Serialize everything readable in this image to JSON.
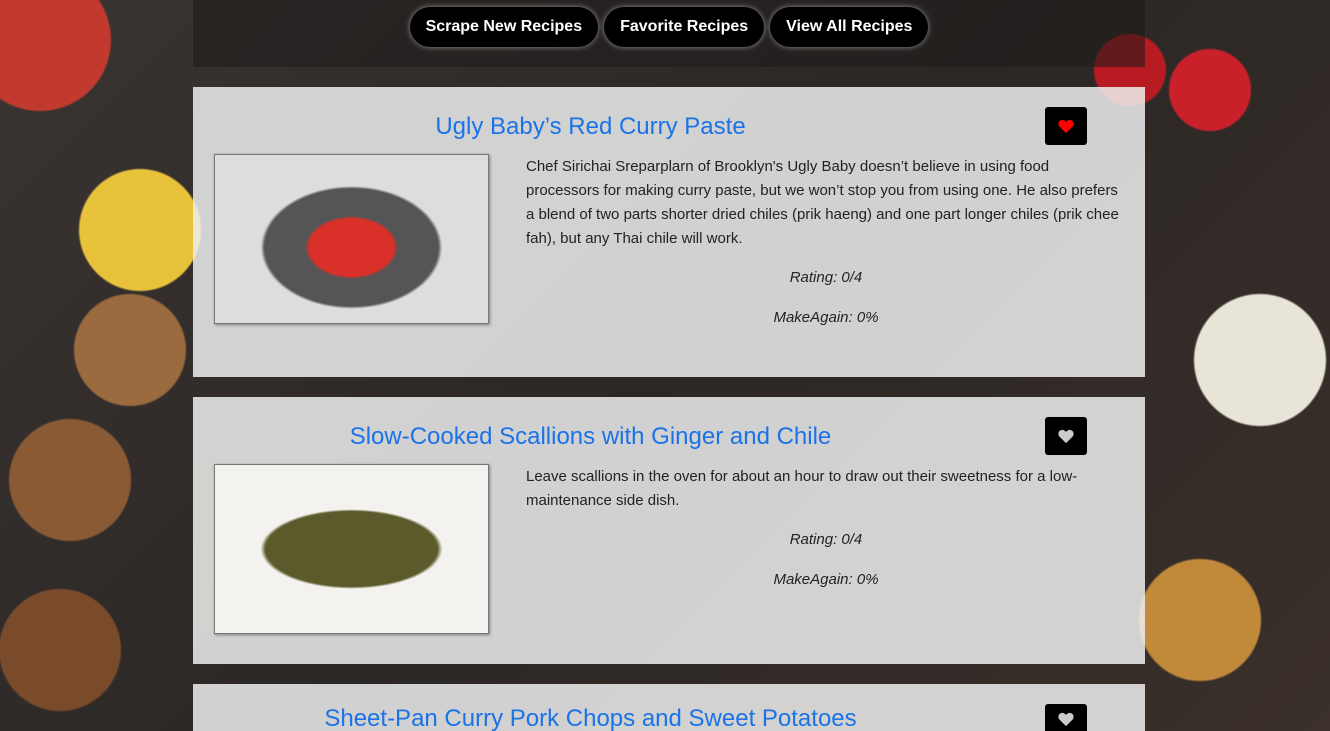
{
  "nav": {
    "scrape": "Scrape New Recipes",
    "favorites": "Favorite Recipes",
    "all": "View All Recipes"
  },
  "recipes": [
    {
      "title": "Ugly Baby’s Red Curry Paste",
      "description": "Chef Sirichai Sreparplarn of Brooklyn's Ugly Baby doesn’t believe in using food processors for making curry paste, but we won’t stop you from using one. He also prefers a blend of two parts shorter dried chiles (prik haeng) and one part longer chiles (prik chee fah), but any Thai chile will work.",
      "rating": "Rating: 0/4",
      "make_again": "MakeAgain: 0%",
      "favorite": true,
      "heart_color": "#ff0000"
    },
    {
      "title": "Slow-Cooked Scallions with Ginger and Chile",
      "description": "Leave scallions in the oven for about an hour to draw out their sweetness for a low-maintenance side dish.",
      "rating": "Rating: 0/4",
      "make_again": "MakeAgain: 0%",
      "favorite": false,
      "heart_color": "#cccccc"
    },
    {
      "title": "Sheet-Pan Curry Pork Chops and Sweet Potatoes",
      "favorite": false,
      "heart_color": "#cccccc"
    }
  ]
}
